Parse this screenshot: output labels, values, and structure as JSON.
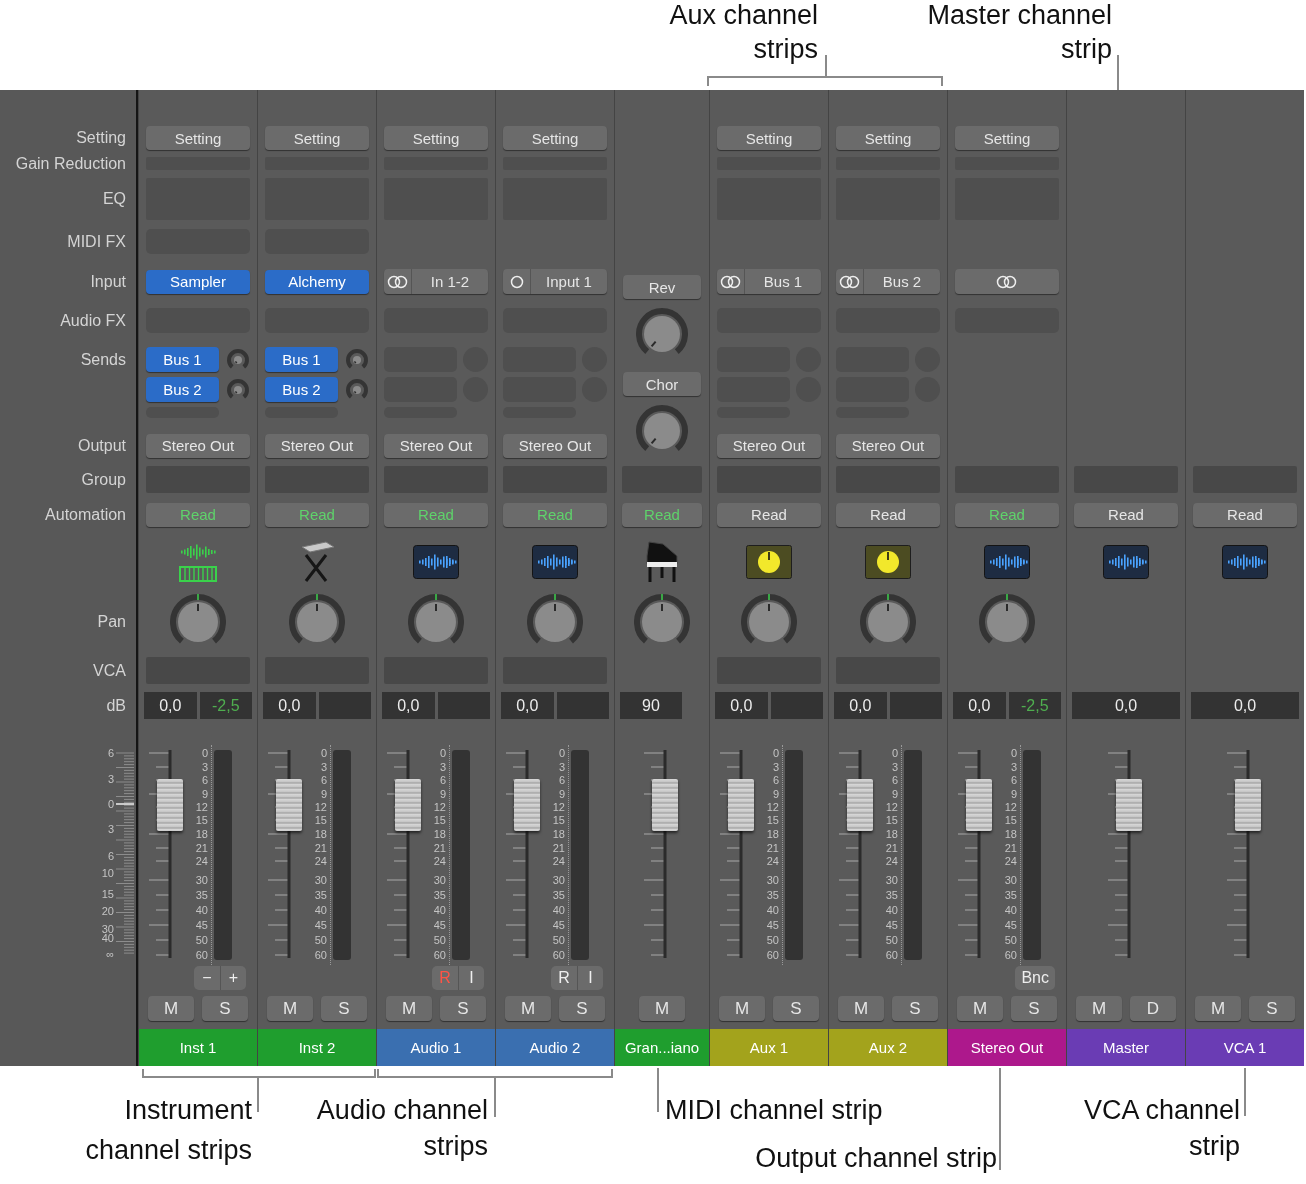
{
  "callouts_top": [
    {
      "lines": [
        "Aux channel",
        "strips"
      ]
    },
    {
      "lines": [
        "Master channel",
        "strip"
      ]
    }
  ],
  "row_labels": [
    "Setting",
    "Gain Reduction",
    "EQ",
    "MIDI FX",
    "Input",
    "Audio FX",
    "Sends",
    "Output",
    "Group",
    "Automation",
    "Pan",
    "VCA",
    "dB"
  ],
  "fader_scale": [
    "6",
    "3",
    "0",
    "3",
    "6",
    "10",
    "15",
    "20",
    "30",
    "40",
    "∞"
  ],
  "strips": [
    {
      "kind": "instrument",
      "name": "Inst 1",
      "color": "#1f9e2e",
      "setting": "Setting",
      "gain_reduction": true,
      "eq": true,
      "midi_fx": true,
      "input": {
        "kind": "plugin",
        "label": "Sampler"
      },
      "audio_fx": true,
      "sends": {
        "kind": "buttons",
        "items": [
          {
            "label": "Bus 1"
          },
          {
            "label": "Bus 2"
          }
        ]
      },
      "output": "Stereo Out",
      "group": true,
      "automation": {
        "label": "Read",
        "on": true
      },
      "icon": {
        "kind": "waveform-keys"
      },
      "pan": true,
      "vca": true,
      "db": {
        "kind": "pair",
        "value": "0,0",
        "peak": "-2,5"
      },
      "fader": {
        "level": 0.74,
        "meter_scale": [
          "0",
          "3",
          "6",
          "9",
          "12",
          "15",
          "18",
          "21",
          "24",
          "30",
          "35",
          "40",
          "45",
          "50",
          "60"
        ]
      },
      "small_buttons": [
        {
          "label": "−",
          "armed": false
        },
        {
          "label": "+",
          "armed": false
        }
      ],
      "buttons": [
        "M",
        "S"
      ]
    },
    {
      "kind": "instrument",
      "name": "Inst 2",
      "color": "#1f9e2e",
      "setting": "Setting",
      "gain_reduction": true,
      "eq": true,
      "midi_fx": true,
      "input": {
        "kind": "plugin",
        "label": "Alchemy"
      },
      "audio_fx": true,
      "sends": {
        "kind": "buttons",
        "items": [
          {
            "label": "Bus 1"
          },
          {
            "label": "Bus 2"
          }
        ]
      },
      "output": "Stereo Out",
      "group": true,
      "automation": {
        "label": "Read",
        "on": true
      },
      "icon": {
        "kind": "keyboard-stand"
      },
      "pan": true,
      "vca": true,
      "db": {
        "kind": "pair",
        "value": "0,0"
      },
      "fader": {
        "level": 0.74,
        "meter_scale": [
          "0",
          "3",
          "6",
          "9",
          "12",
          "15",
          "18",
          "21",
          "24",
          "30",
          "35",
          "40",
          "45",
          "50",
          "60"
        ]
      },
      "buttons": [
        "M",
        "S"
      ]
    },
    {
      "kind": "audio",
      "name": "Audio 1",
      "color": "#3a6fb0",
      "setting": "Setting",
      "gain_reduction": true,
      "eq": true,
      "input": {
        "kind": "stereo",
        "label": "In 1-2"
      },
      "audio_fx": true,
      "sends": {
        "kind": "empty"
      },
      "output": "Stereo Out",
      "group": true,
      "automation": {
        "label": "Read",
        "on": true
      },
      "icon": {
        "kind": "waveform"
      },
      "pan": true,
      "vca": true,
      "db": {
        "kind": "pair",
        "value": "0,0"
      },
      "fader": {
        "level": 0.74,
        "meter_scale": [
          "0",
          "3",
          "6",
          "9",
          "12",
          "15",
          "18",
          "21",
          "24",
          "30",
          "35",
          "40",
          "45",
          "50",
          "60"
        ]
      },
      "small_buttons": [
        {
          "label": "R",
          "armed": true
        },
        {
          "label": "I",
          "armed": false
        }
      ],
      "buttons": [
        "M",
        "S"
      ]
    },
    {
      "kind": "audio",
      "name": "Audio 2",
      "color": "#3a6fb0",
      "setting": "Setting",
      "gain_reduction": true,
      "eq": true,
      "input": {
        "kind": "mono",
        "label": "Input 1"
      },
      "audio_fx": true,
      "sends": {
        "kind": "empty"
      },
      "output": "Stereo Out",
      "group": true,
      "automation": {
        "label": "Read",
        "on": true
      },
      "icon": {
        "kind": "waveform"
      },
      "pan": true,
      "vca": true,
      "db": {
        "kind": "pair",
        "value": "0,0"
      },
      "fader": {
        "level": 0.74,
        "meter_scale": [
          "0",
          "3",
          "6",
          "9",
          "12",
          "15",
          "18",
          "21",
          "24",
          "30",
          "35",
          "40",
          "45",
          "50",
          "60"
        ]
      },
      "small_buttons": [
        {
          "label": "R",
          "armed": false
        },
        {
          "label": "I",
          "armed": false
        }
      ],
      "buttons": [
        "M",
        "S"
      ]
    },
    {
      "kind": "midi",
      "name": "Gran...iano",
      "color": "#1f9e2e",
      "sends": {
        "kind": "knobs",
        "items": [
          {
            "label": "Rev"
          },
          {
            "label": "Chor"
          }
        ]
      },
      "group": true,
      "automation": {
        "label": "Read",
        "on": true
      },
      "icon": {
        "kind": "piano"
      },
      "pan": true,
      "db": {
        "kind": "dot",
        "value": "90"
      },
      "fader": {
        "level": 0.74
      },
      "buttons": [
        "M"
      ]
    },
    {
      "kind": "aux",
      "name": "Aux 1",
      "color": "#a3a31c",
      "setting": "Setting",
      "gain_reduction": true,
      "eq": true,
      "input": {
        "kind": "stereo",
        "label": "Bus 1"
      },
      "audio_fx": true,
      "sends": {
        "kind": "empty"
      },
      "output": "Stereo Out",
      "group": true,
      "automation": {
        "label": "Read",
        "on": false
      },
      "icon": {
        "kind": "aux-knob"
      },
      "pan": true,
      "vca": true,
      "db": {
        "kind": "pair",
        "value": "0,0"
      },
      "fader": {
        "level": 0.74,
        "meter_scale": [
          "0",
          "3",
          "6",
          "9",
          "12",
          "15",
          "18",
          "21",
          "24",
          "30",
          "35",
          "40",
          "45",
          "50",
          "60"
        ]
      },
      "buttons": [
        "M",
        "S"
      ]
    },
    {
      "kind": "aux",
      "name": "Aux 2",
      "color": "#a3a31c",
      "setting": "Setting",
      "gain_reduction": true,
      "eq": true,
      "input": {
        "kind": "stereo",
        "label": "Bus 2"
      },
      "audio_fx": true,
      "sends": {
        "kind": "empty"
      },
      "output": "Stereo Out",
      "group": true,
      "automation": {
        "label": "Read",
        "on": false
      },
      "icon": {
        "kind": "aux-knob"
      },
      "pan": true,
      "vca": true,
      "db": {
        "kind": "pair",
        "value": "0,0"
      },
      "fader": {
        "level": 0.74,
        "meter_scale": [
          "0",
          "3",
          "6",
          "9",
          "12",
          "15",
          "18",
          "21",
          "24",
          "30",
          "35",
          "40",
          "45",
          "50",
          "60"
        ]
      },
      "buttons": [
        "M",
        "S"
      ]
    },
    {
      "kind": "output",
      "name": "Stereo Out",
      "color": "#ad188c",
      "setting": "Setting",
      "gain_reduction": true,
      "eq": true,
      "input": {
        "kind": "stereo"
      },
      "audio_fx": true,
      "group": true,
      "automation": {
        "label": "Read",
        "on": true
      },
      "icon": {
        "kind": "waveform"
      },
      "pan": true,
      "db": {
        "kind": "pair",
        "value": "0,0",
        "peak": "-2,5"
      },
      "fader": {
        "level": 0.74,
        "meter_scale": [
          "0",
          "3",
          "6",
          "9",
          "12",
          "15",
          "18",
          "21",
          "24",
          "30",
          "35",
          "40",
          "45",
          "50",
          "60"
        ]
      },
      "small_buttons": [
        {
          "label": "Bnc",
          "armed": false
        }
      ],
      "buttons": [
        "M",
        "S"
      ]
    },
    {
      "kind": "master",
      "name": "Master",
      "color": "#6a3cb4",
      "group": true,
      "automation": {
        "label": "Read",
        "on": false
      },
      "icon": {
        "kind": "waveform"
      },
      "db": {
        "kind": "single",
        "value": "0,0"
      },
      "fader": {
        "level": 0.74
      },
      "buttons": [
        "M",
        "D"
      ]
    },
    {
      "kind": "vca",
      "name": "VCA 1",
      "color": "#6a3cb4",
      "group": true,
      "automation": {
        "label": "Read",
        "on": false
      },
      "icon": {
        "kind": "waveform"
      },
      "db": {
        "kind": "single",
        "value": "0,0"
      },
      "fader": {
        "level": 0.74
      },
      "buttons": [
        "M",
        "S"
      ]
    }
  ],
  "callouts_bottom": [
    {
      "lines": [
        "Instrument",
        "channel strips"
      ]
    },
    {
      "lines": [
        "Audio channel",
        "strips"
      ]
    },
    {
      "lines": [
        "MIDI channel strip"
      ]
    },
    {
      "lines": [
        "Output channel strip"
      ]
    },
    {
      "lines": [
        "VCA channel",
        "strip"
      ]
    }
  ]
}
